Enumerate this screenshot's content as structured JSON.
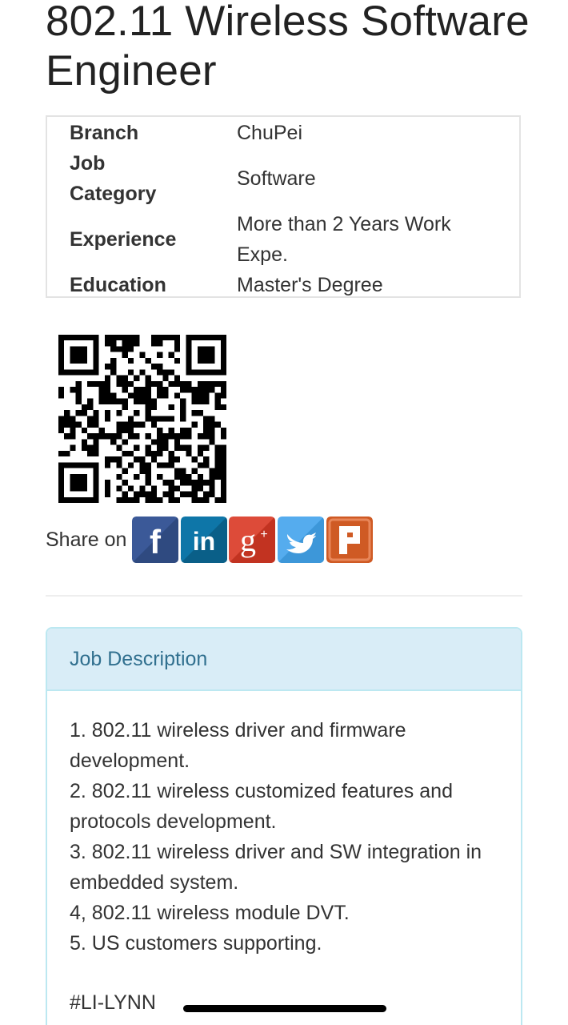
{
  "job": {
    "title": "802.11 Wireless Software Engineer"
  },
  "details": [
    {
      "label": "Branch",
      "value": "ChuPei"
    },
    {
      "label": "Job Category",
      "value": "Software"
    },
    {
      "label": "Experience",
      "value": "More than 2 Years Work Expe."
    },
    {
      "label": "Education",
      "value": "Master's Degree"
    }
  ],
  "share": {
    "label": "Share on",
    "buttons": [
      {
        "name": "facebook",
        "icon": "facebook-icon",
        "color": "#3b5998"
      },
      {
        "name": "linkedin",
        "icon": "linkedin-icon",
        "color": "#0e76a8"
      },
      {
        "name": "google-plus",
        "icon": "google-plus-icon",
        "color": "#dd4b39"
      },
      {
        "name": "twitter",
        "icon": "twitter-icon",
        "color": "#55acee"
      },
      {
        "name": "plurk",
        "icon": "plurk-icon",
        "color": "#cf5a24"
      }
    ]
  },
  "description": {
    "heading": "Job Description",
    "lines": [
      "1. 802.11 wireless driver and firmware development.",
      "2. 802.11 wireless customized features and protocols development.",
      "3. 802.11 wireless driver and SW integration in embedded system.",
      "4, 802.11 wireless module DVT.",
      "5. US customers supporting."
    ],
    "tag": "#LI-LYNN"
  },
  "colors": {
    "panel_heading_bg": "#d9edf7",
    "panel_border": "#bce8f1",
    "panel_title": "#31708f"
  }
}
